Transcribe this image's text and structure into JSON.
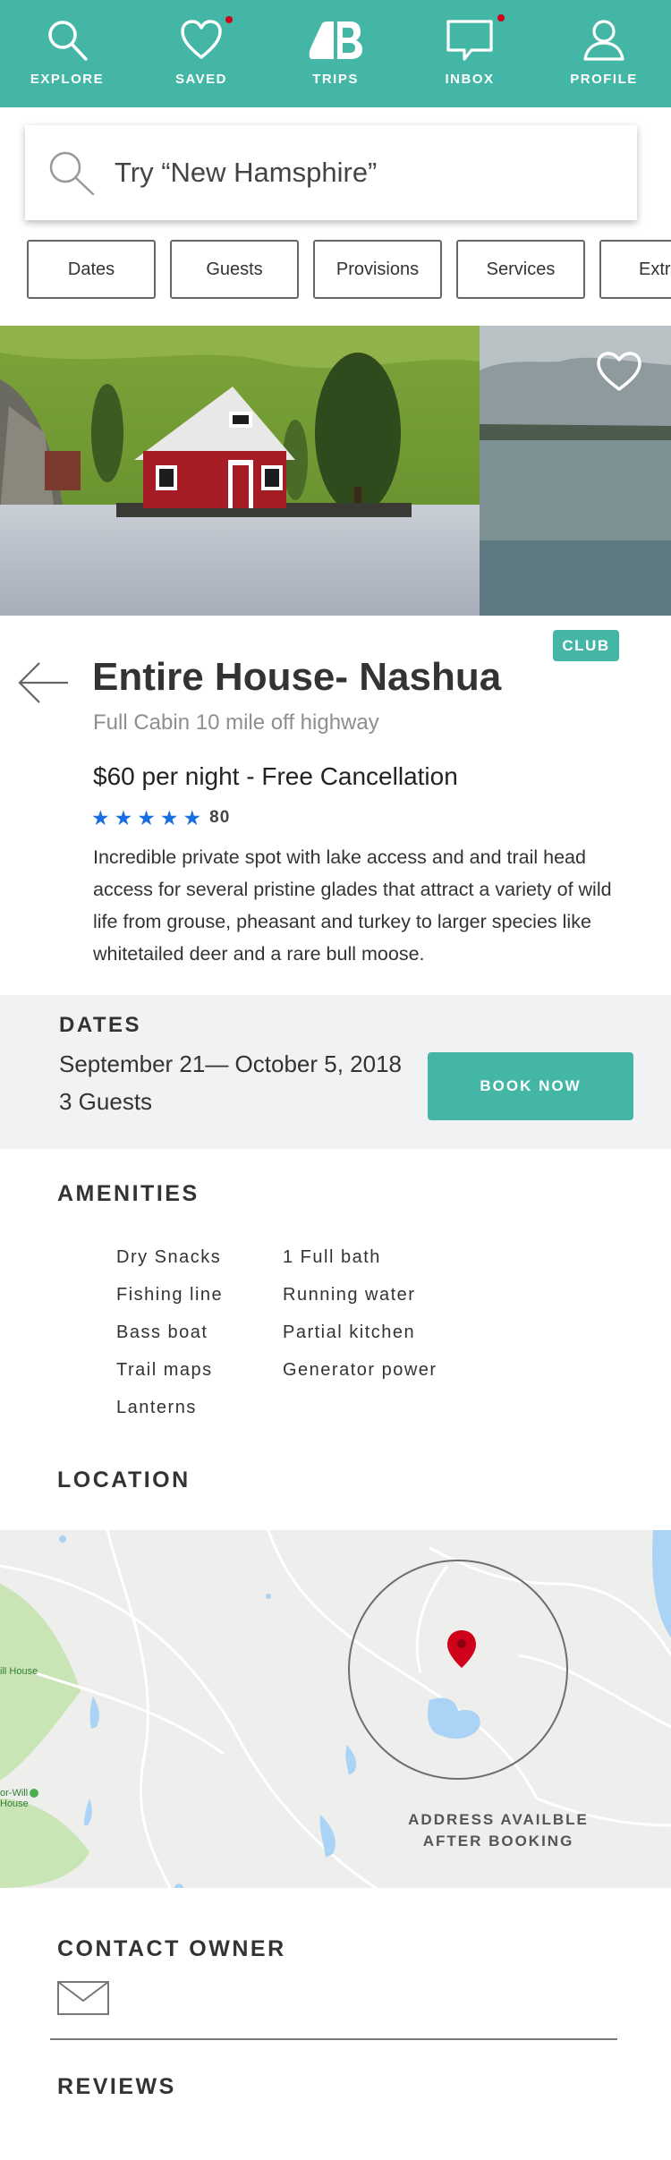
{
  "nav": {
    "items": [
      {
        "label": "EXPLORE",
        "icon": "search-icon"
      },
      {
        "label": "SAVED",
        "icon": "heart-icon",
        "badge": true
      },
      {
        "label": "TRIPS",
        "icon": "trips-logo-icon"
      },
      {
        "label": "INBOX",
        "icon": "message-icon",
        "badge": true
      },
      {
        "label": "PROFILE",
        "icon": "user-icon"
      }
    ],
    "color": "#44b6a6",
    "badge_color": "#d0021b"
  },
  "search": {
    "placeholder": "Try “New Hamsphire”"
  },
  "filters": [
    "Dates",
    "Guests",
    "Provisions",
    "Services",
    "Extras"
  ],
  "listing": {
    "badge": "CLUB",
    "title": "Entire House- Nashua",
    "subtitle": "Full Cabin 10 mile off highway",
    "price": "$60 per night - Free Cancellation",
    "rating_stars": 5,
    "rating_count": "80",
    "description": "Incredible private spot with lake access and  and trail head access for several pristine glades that attract a variety of wild life from grouse, pheasant and turkey to larger species like whitetailed deer and a rare bull moose."
  },
  "dates": {
    "heading": "DATES",
    "range": "September 21— October 5, 2018",
    "guests": "3 Guests",
    "book_label": "BOOK NOW"
  },
  "amenities": {
    "heading": "AMENITIES",
    "left": [
      "Dry Snacks",
      "Fishing line",
      "Bass boat",
      "Trail maps",
      "Lanterns"
    ],
    "right": [
      "1 Full bath",
      "Running water",
      "Partial kitchen",
      "Generator power"
    ]
  },
  "location": {
    "heading": "LOCATION",
    "note_line1": "ADDRESS AVAILBLE",
    "note_line2": "AFTER BOOKING",
    "map_label_1": "ill House",
    "map_label_2a": "or-Will",
    "map_label_2b": "House",
    "pin_color": "#d0021b"
  },
  "contact": {
    "heading": "CONTACT OWNER"
  },
  "reviews": {
    "heading": "REVIEWS"
  },
  "accent": "#44b6a6",
  "star_color": "#1a6fe0"
}
